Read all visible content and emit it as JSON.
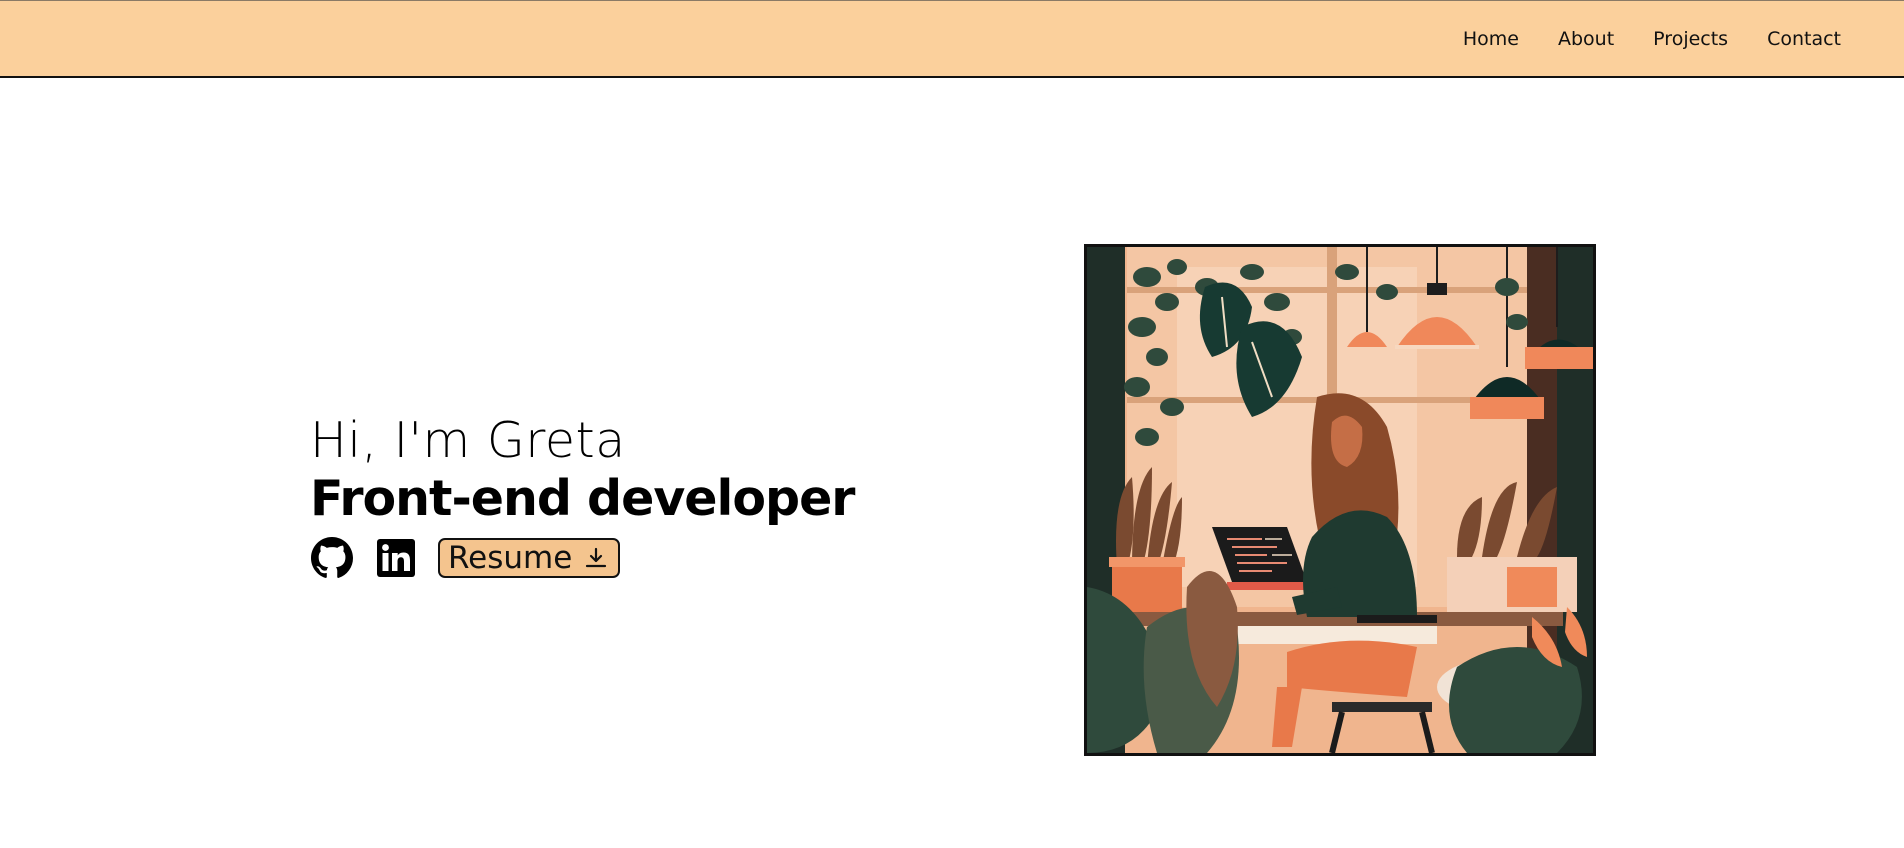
{
  "nav": {
    "links": [
      "Home",
      "About",
      "Projects",
      "Contact"
    ]
  },
  "hero": {
    "greeting": "Hi, I'm Greta",
    "role": "Front-end developer",
    "resume_label": "Resume"
  },
  "icons": {
    "github": "github-icon",
    "linkedin": "linkedin-icon",
    "download": "download-icon"
  },
  "colors": {
    "header_bg": "#fbd09c",
    "resume_bg": "#f4c48e",
    "text": "#111111"
  }
}
